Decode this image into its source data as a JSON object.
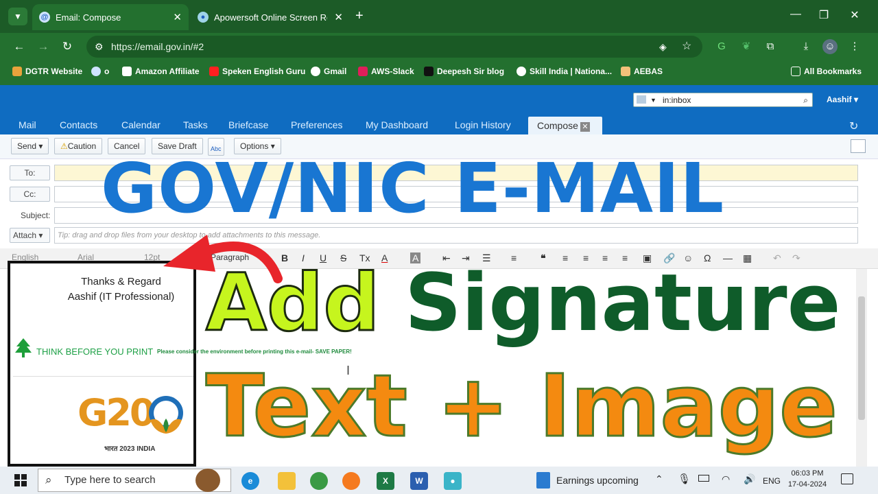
{
  "browser": {
    "tabs": [
      {
        "title": "Email: Compose",
        "close": "✕"
      },
      {
        "title": "Apowersoft Online Screen Rec",
        "close": "✕"
      }
    ],
    "new_tab": "+",
    "url": "https://email.gov.in/#2",
    "bookmarks": [
      "DGTR Website",
      "o",
      "Amazon Affiliate",
      "Speken English Guru",
      "Gmail",
      "AWS-Slack",
      "Deepesh  Sir  blog",
      "Skill India | Nationa...",
      "AEBAS"
    ],
    "all_bookmarks": "All Bookmarks"
  },
  "mail": {
    "search_value": "in:inbox",
    "user": "Aashif",
    "nav_tabs": [
      "Mail",
      "Contacts",
      "Calendar",
      "Tasks",
      "Briefcase",
      "Preferences",
      "My Dashboard",
      "Login History"
    ],
    "compose_tab": "Compose",
    "toolbar": {
      "send": "Send",
      "caution": "Caution",
      "cancel": "Cancel",
      "save_draft": "Save Draft",
      "spell": "Abc",
      "options": "Options"
    },
    "fields": {
      "to": "To:",
      "cc": "Cc:",
      "subject": "Subject:",
      "attach": "Attach",
      "attach_hint": "Tip: drag and drop files from your desktop to add attachments to this message."
    },
    "editor": {
      "language": "English",
      "font": "Arial",
      "size": "12pt",
      "paragraph": "Paragraph"
    }
  },
  "signature": {
    "line1": "Thanks & Regard",
    "line2": "Aashif (IT Professional)",
    "print_note": "THINK BEFORE YOU PRINT",
    "print_detail": "Please consider the environment before printing this e-mail- SAVE PAPER!",
    "logo_text": "G20",
    "logo_sub": "भारत 2023 INDIA"
  },
  "overlay": {
    "title": "GOV/NIC E-MAIL",
    "add": "Add",
    "signature": "Signature",
    "text_image": "Text + Image"
  },
  "taskbar": {
    "search_placeholder": "Type here to search",
    "news": "Earnings upcoming",
    "lang": "ENG",
    "time": "06:03 PM",
    "date": "17-04-2024"
  },
  "colors": {
    "chrome_green": "#1c5b27",
    "app_blue": "#0f6cc1",
    "title_blue": "#1976d2",
    "add_lime": "#c6f51e",
    "signature_green": "#0f5c2a",
    "text_orange": "#f48a10"
  }
}
